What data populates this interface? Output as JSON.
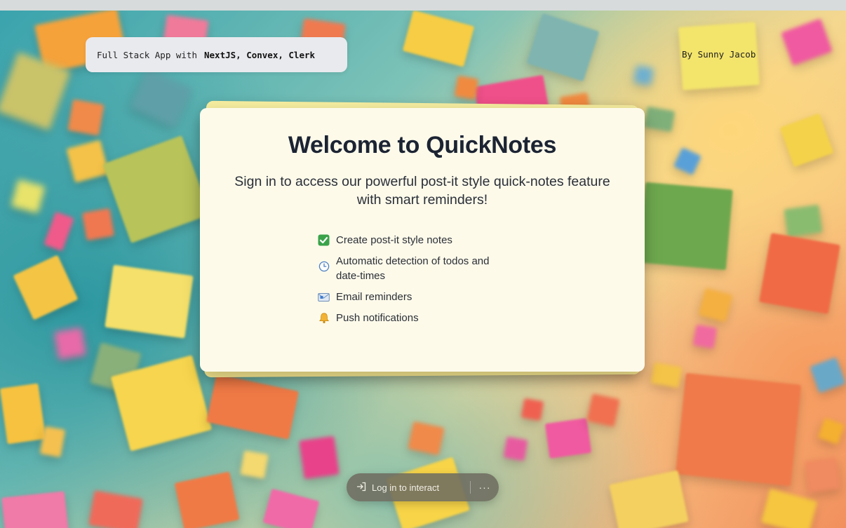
{
  "header": {
    "chip_prefix": "Full Stack App with",
    "chip_stack": "NextJS, Convex, Clerk",
    "byline": "By Sunny Jacob"
  },
  "card": {
    "title": "Welcome to QuickNotes",
    "subtitle": "Sign in to access our powerful post-it style quick-notes feature with smart reminders!",
    "features": [
      {
        "icon": "check-mark-icon",
        "text": "Create post-it style notes"
      },
      {
        "icon": "clock-icon",
        "text": "Automatic detection of todos and date-times"
      },
      {
        "icon": "envelope-icon",
        "text": "Email reminders"
      },
      {
        "icon": "bell-icon",
        "text": "Push notifications"
      }
    ]
  },
  "footer": {
    "login_label": "Log in to interact",
    "more_label": "···"
  },
  "colors": {
    "card_bg": "#fdfaea",
    "title": "#1c2433",
    "check": "#3aa34a",
    "bell": "#f2b233"
  }
}
